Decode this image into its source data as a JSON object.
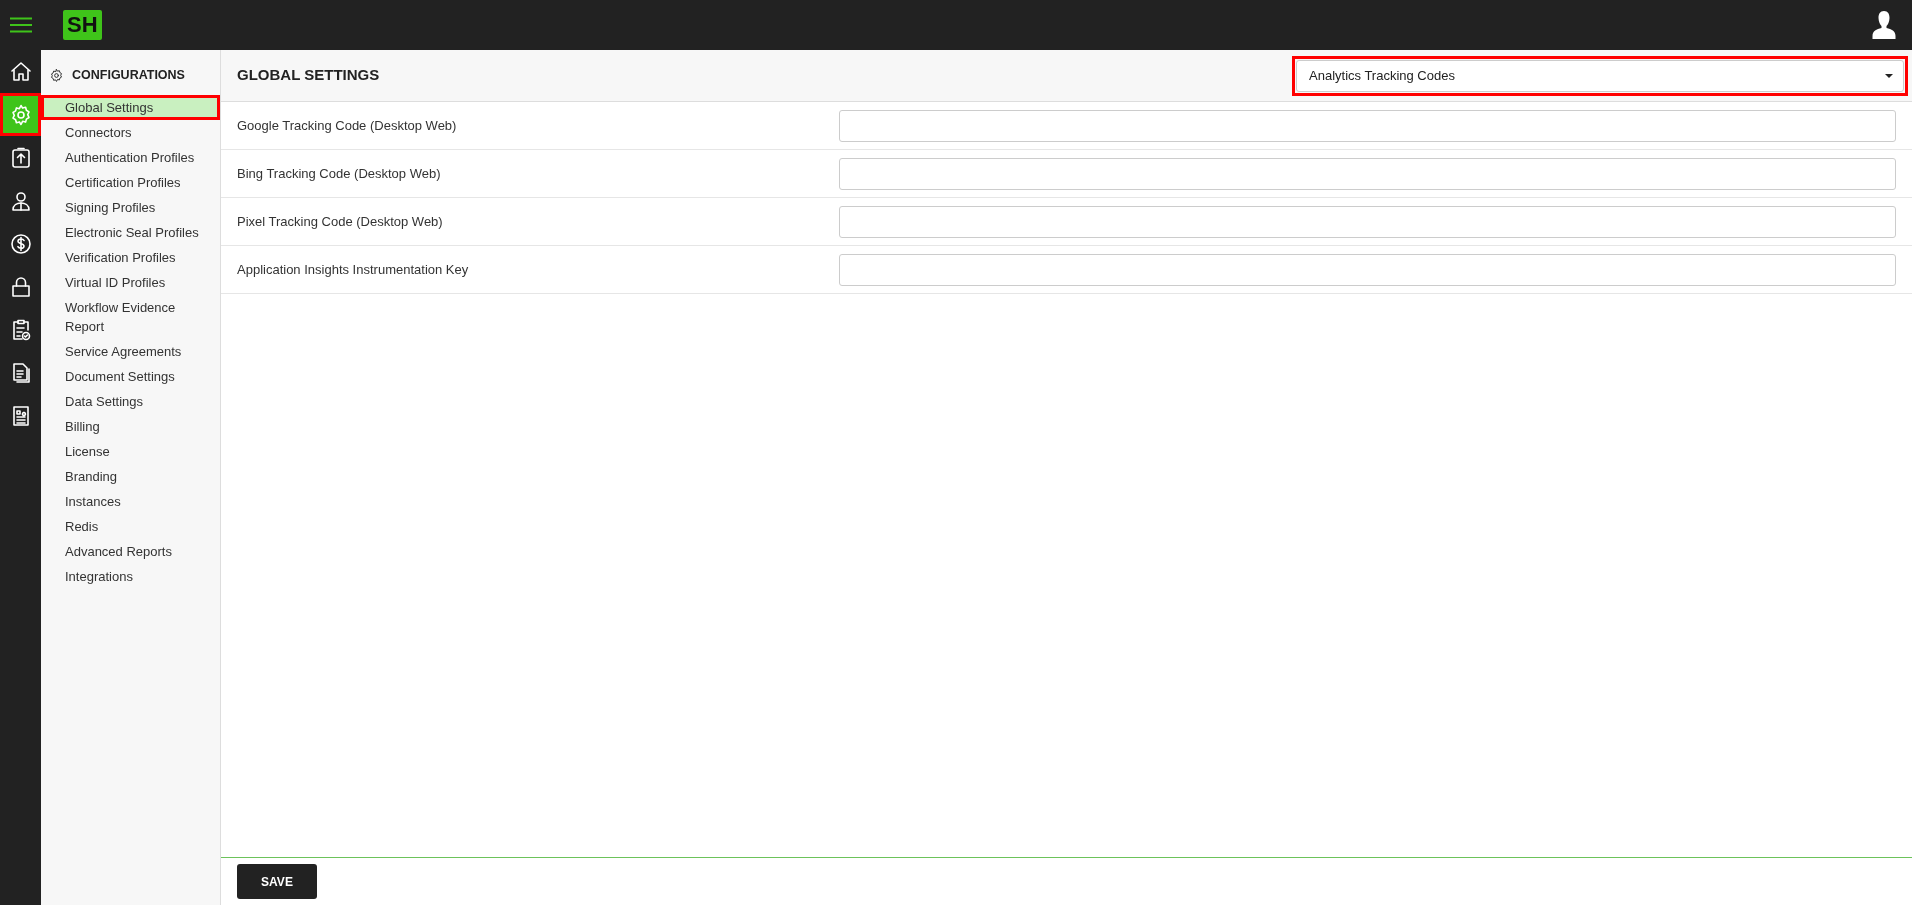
{
  "topbar": {
    "logo": "SH"
  },
  "rail": [
    {
      "kind": "home",
      "selected": false,
      "highlighted": false
    },
    {
      "kind": "gear",
      "selected": true,
      "highlighted": true
    },
    {
      "kind": "upload",
      "selected": false,
      "highlighted": false
    },
    {
      "kind": "person",
      "selected": false,
      "highlighted": false
    },
    {
      "kind": "dollar",
      "selected": false,
      "highlighted": false
    },
    {
      "kind": "lock",
      "selected": false,
      "highlighted": false
    },
    {
      "kind": "clipboard",
      "selected": false,
      "highlighted": false
    },
    {
      "kind": "document",
      "selected": false,
      "highlighted": false
    },
    {
      "kind": "report",
      "selected": false,
      "highlighted": false
    }
  ],
  "sidebar": {
    "title": "CONFIGURATIONS",
    "items": [
      {
        "label": "Global Settings",
        "selected": true,
        "highlighted": true
      },
      {
        "label": "Connectors",
        "selected": false,
        "highlighted": false
      },
      {
        "label": "Authentication Profiles",
        "selected": false,
        "highlighted": false
      },
      {
        "label": "Certification Profiles",
        "selected": false,
        "highlighted": false
      },
      {
        "label": "Signing Profiles",
        "selected": false,
        "highlighted": false
      },
      {
        "label": "Electronic Seal Profiles",
        "selected": false,
        "highlighted": false
      },
      {
        "label": "Verification Profiles",
        "selected": false,
        "highlighted": false
      },
      {
        "label": "Virtual ID Profiles",
        "selected": false,
        "highlighted": false
      },
      {
        "label": "Workflow Evidence Report",
        "selected": false,
        "highlighted": false
      },
      {
        "label": "Service Agreements",
        "selected": false,
        "highlighted": false
      },
      {
        "label": "Document Settings",
        "selected": false,
        "highlighted": false
      },
      {
        "label": "Data Settings",
        "selected": false,
        "highlighted": false
      },
      {
        "label": "Billing",
        "selected": false,
        "highlighted": false
      },
      {
        "label": "License",
        "selected": false,
        "highlighted": false
      },
      {
        "label": "Branding",
        "selected": false,
        "highlighted": false
      },
      {
        "label": "Instances",
        "selected": false,
        "highlighted": false
      },
      {
        "label": "Redis",
        "selected": false,
        "highlighted": false
      },
      {
        "label": "Advanced Reports",
        "selected": false,
        "highlighted": false
      },
      {
        "label": "Integrations",
        "selected": false,
        "highlighted": false
      }
    ]
  },
  "main": {
    "title": "GLOBAL SETTINGS",
    "section_select": {
      "value": "Analytics Tracking Codes",
      "highlighted": true
    },
    "fields": [
      {
        "label": "Google Tracking Code (Desktop Web)"
      },
      {
        "label": "Bing Tracking Code (Desktop Web)"
      },
      {
        "label": "Pixel Tracking Code (Desktop Web)"
      },
      {
        "label": "Application Insights Instrumentation Key"
      }
    ],
    "save_button": "SAVE"
  }
}
